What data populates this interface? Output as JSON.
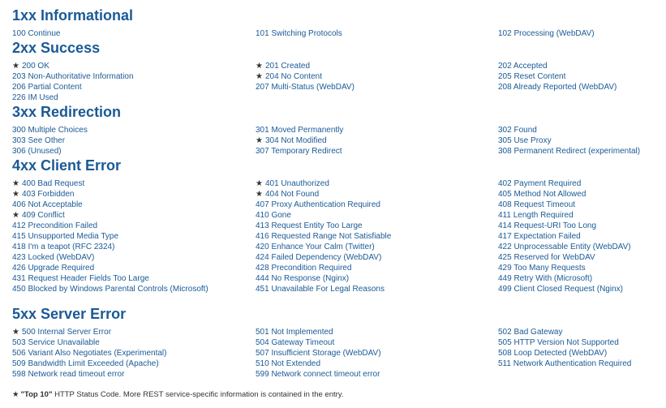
{
  "sections": [
    {
      "title": "1xx Informational",
      "items": [
        {
          "label": "100 Continue",
          "top": false
        },
        {
          "label": "101 Switching Protocols",
          "top": false
        },
        {
          "label": "102 Processing (WebDAV)",
          "top": false
        }
      ]
    },
    {
      "title": "2xx Success",
      "items": [
        {
          "label": "200 OK",
          "top": true
        },
        {
          "label": "201 Created",
          "top": true
        },
        {
          "label": "202 Accepted",
          "top": false
        },
        {
          "label": "203 Non-Authoritative Information",
          "top": false
        },
        {
          "label": "204 No Content",
          "top": true
        },
        {
          "label": "205 Reset Content",
          "top": false
        },
        {
          "label": "206 Partial Content",
          "top": false
        },
        {
          "label": "207 Multi-Status (WebDAV)",
          "top": false
        },
        {
          "label": "208 Already Reported (WebDAV)",
          "top": false
        },
        {
          "label": "226 IM Used",
          "top": false
        }
      ]
    },
    {
      "title": "3xx Redirection",
      "items": [
        {
          "label": "300 Multiple Choices",
          "top": false
        },
        {
          "label": "301 Moved Permanently",
          "top": false
        },
        {
          "label": "302 Found",
          "top": false
        },
        {
          "label": "303 See Other",
          "top": false
        },
        {
          "label": "304 Not Modified",
          "top": true
        },
        {
          "label": "305 Use Proxy",
          "top": false
        },
        {
          "label": "306 (Unused)",
          "top": false
        },
        {
          "label": "307 Temporary Redirect",
          "top": false
        },
        {
          "label": "308 Permanent Redirect (experimental)",
          "top": false
        }
      ]
    },
    {
      "title": "4xx Client Error",
      "items": [
        {
          "label": "400 Bad Request",
          "top": true
        },
        {
          "label": "401 Unauthorized",
          "top": true
        },
        {
          "label": "402 Payment Required",
          "top": false
        },
        {
          "label": "403 Forbidden",
          "top": true
        },
        {
          "label": "404 Not Found",
          "top": true
        },
        {
          "label": "405 Method Not Allowed",
          "top": false
        },
        {
          "label": "406 Not Acceptable",
          "top": false
        },
        {
          "label": "407 Proxy Authentication Required",
          "top": false
        },
        {
          "label": "408 Request Timeout",
          "top": false
        },
        {
          "label": "409 Conflict",
          "top": true
        },
        {
          "label": "410 Gone",
          "top": false
        },
        {
          "label": "411 Length Required",
          "top": false
        },
        {
          "label": "412 Precondition Failed",
          "top": false
        },
        {
          "label": "413 Request Entity Too Large",
          "top": false
        },
        {
          "label": "414 Request-URI Too Long",
          "top": false
        },
        {
          "label": "415 Unsupported Media Type",
          "top": false
        },
        {
          "label": "416 Requested Range Not Satisfiable",
          "top": false
        },
        {
          "label": "417 Expectation Failed",
          "top": false
        },
        {
          "label": "418 I'm a teapot (RFC 2324)",
          "top": false
        },
        {
          "label": "420 Enhance Your Calm (Twitter)",
          "top": false
        },
        {
          "label": "422 Unprocessable Entity (WebDAV)",
          "top": false
        },
        {
          "label": "423 Locked (WebDAV)",
          "top": false
        },
        {
          "label": "424 Failed Dependency (WebDAV)",
          "top": false
        },
        {
          "label": "425 Reserved for WebDAV",
          "top": false
        },
        {
          "label": "426 Upgrade Required",
          "top": false
        },
        {
          "label": "428 Precondition Required",
          "top": false
        },
        {
          "label": "429 Too Many Requests",
          "top": false
        },
        {
          "label": "431 Request Header Fields Too Large",
          "top": false
        },
        {
          "label": "444 No Response (Nginx)",
          "top": false
        },
        {
          "label": "449 Retry With (Microsoft)",
          "top": false
        },
        {
          "label": "450 Blocked by Windows Parental Controls (Microsoft)",
          "top": false
        },
        {
          "label": "451 Unavailable For Legal Reasons",
          "top": false
        },
        {
          "label": "499 Client Closed Request (Nginx)",
          "top": false
        }
      ]
    },
    {
      "title": "5xx Server Error",
      "items": [
        {
          "label": "500 Internal Server Error",
          "top": true
        },
        {
          "label": "501 Not Implemented",
          "top": false
        },
        {
          "label": "502 Bad Gateway",
          "top": false
        },
        {
          "label": "503 Service Unavailable",
          "top": false
        },
        {
          "label": "504 Gateway Timeout",
          "top": false
        },
        {
          "label": "505 HTTP Version Not Supported",
          "top": false
        },
        {
          "label": "506 Variant Also Negotiates (Experimental)",
          "top": false
        },
        {
          "label": "507 Insufficient Storage (WebDAV)",
          "top": false
        },
        {
          "label": "508 Loop Detected (WebDAV)",
          "top": false
        },
        {
          "label": "509 Bandwidth Limit Exceeded (Apache)",
          "top": false
        },
        {
          "label": "510 Not Extended",
          "top": false
        },
        {
          "label": "511 Network Authentication Required",
          "top": false
        },
        {
          "label": "598 Network read timeout error",
          "top": false
        },
        {
          "label": "599 Network connect timeout error",
          "top": false
        }
      ]
    }
  ],
  "footer": {
    "star": "★",
    "bold": "\"Top 10\"",
    "text": " HTTP Status Code. More REST service-specific information is contained in the entry."
  },
  "star_glyph": "★",
  "colors": {
    "heading": "#1a5a96",
    "link": "#1a5a96",
    "star": "#333333"
  }
}
